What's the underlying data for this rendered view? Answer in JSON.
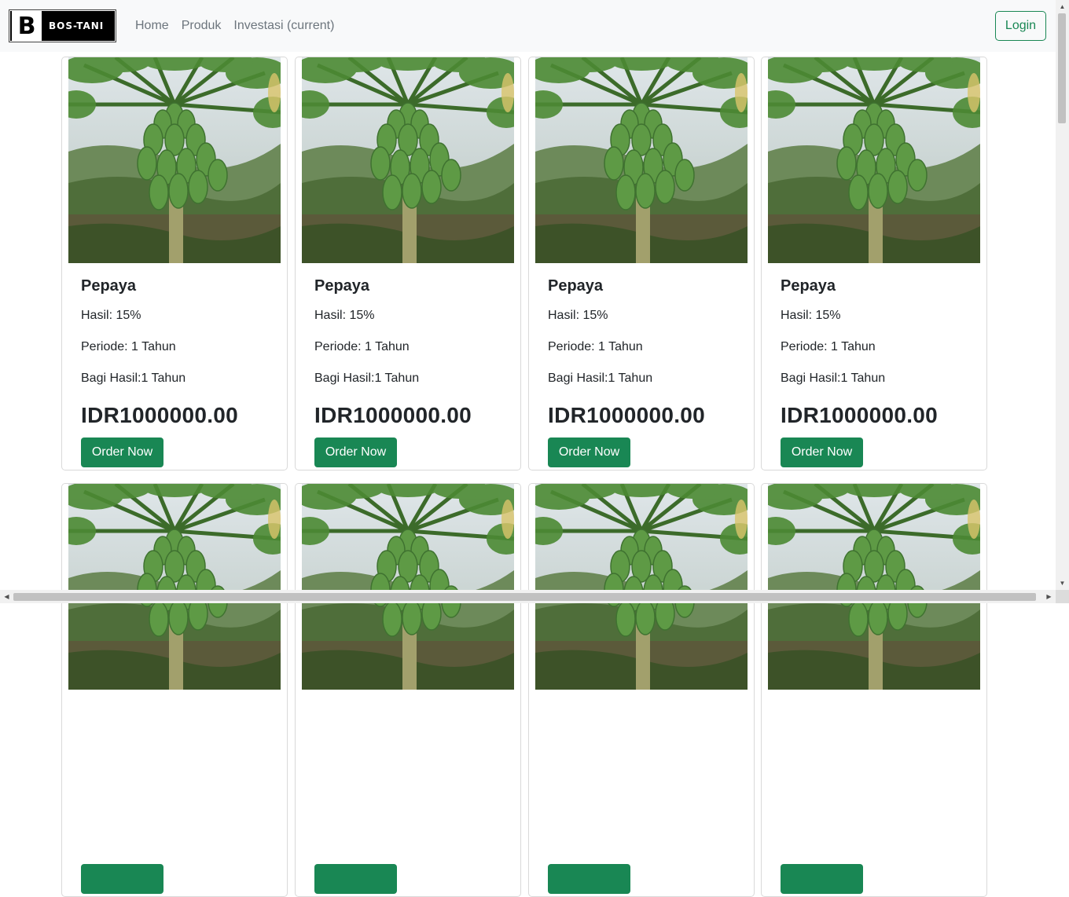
{
  "navbar": {
    "brand_letter": "B",
    "brand_text": "BOS-TANI",
    "links": [
      "Home",
      "Produk",
      "Investasi (current)"
    ],
    "login_label": "Login"
  },
  "products": [
    {
      "name": "Pepaya",
      "hasil": "Hasil: 15%",
      "periode": "Periode: 1 Tahun",
      "bagi_hasil": "Bagi Hasil:1 Tahun",
      "price": "IDR1000000.00",
      "button": "Order Now"
    },
    {
      "name": "Pepaya",
      "hasil": "Hasil: 15%",
      "periode": "Periode: 1 Tahun",
      "bagi_hasil": "Bagi Hasil:1 Tahun",
      "price": "IDR1000000.00",
      "button": "Order Now"
    },
    {
      "name": "Pepaya",
      "hasil": "Hasil: 15%",
      "periode": "Periode: 1 Tahun",
      "bagi_hasil": "Bagi Hasil:1 Tahun",
      "price": "IDR1000000.00",
      "button": "Order Now"
    },
    {
      "name": "Pepaya",
      "hasil": "Hasil: 15%",
      "periode": "Periode: 1 Tahun",
      "bagi_hasil": "Bagi Hasil:1 Tahun",
      "price": "IDR1000000.00",
      "button": "Order Now"
    },
    {
      "name": "",
      "hasil": "",
      "periode": "",
      "bagi_hasil": "",
      "price": "",
      "button": ""
    },
    {
      "name": "",
      "hasil": "",
      "periode": "",
      "bagi_hasil": "",
      "price": "",
      "button": ""
    },
    {
      "name": "",
      "hasil": "",
      "periode": "",
      "bagi_hasil": "",
      "price": "",
      "button": ""
    },
    {
      "name": "",
      "hasil": "",
      "periode": "",
      "bagi_hasil": "",
      "price": "",
      "button": ""
    }
  ],
  "colors": {
    "primary_green": "#198754",
    "navbar_bg": "#f8f9fa"
  }
}
